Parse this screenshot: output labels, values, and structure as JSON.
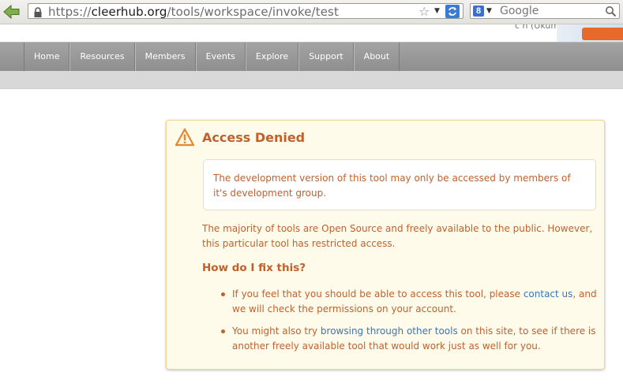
{
  "browser": {
    "url_prefix": "https://",
    "url_domain": "cleerhub.org",
    "url_path": "/tools/workspace/invoke/test",
    "search_placeholder": "Google",
    "search_engine_letter": "8"
  },
  "site": {
    "user_fragment": "c n (Ukumb)",
    "nav": [
      "Home",
      "Resources",
      "Members",
      "Events",
      "Explore",
      "Support",
      "About"
    ]
  },
  "alert": {
    "title": "Access Denied",
    "notice": "The development version of this tool may only be accessed by members of it's development group.",
    "paragraph": "The majority of tools are Open Source and freely available to the public. However, this particular tool has restricted access.",
    "fix_title": "How do I fix this?",
    "item1_before": "If you feel that you should be able to access this tool, please ",
    "item1_link": "contact us",
    "item1_after": ", and we will check the permissions on your account.",
    "item2_before": "You might also try ",
    "item2_link": "browsing through other tools",
    "item2_after": " on this site, to see if there is another freely available tool that would work just as well for you."
  },
  "colors": {
    "alert_text": "#c0612b",
    "link": "#3b75b8",
    "alert_bg": "#fffbeb",
    "nav_bg": "#999999"
  }
}
